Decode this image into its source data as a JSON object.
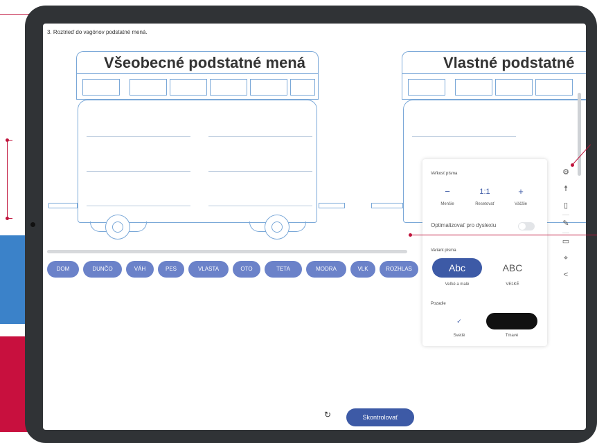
{
  "task": "3. Roztrieď do vagónov podstatné mená.",
  "wagons": [
    {
      "title": "Všeobecné podstatné mená"
    },
    {
      "title": "Vlastné podstatné"
    }
  ],
  "chips": [
    "DOM",
    "DUNČO",
    "VÁH",
    "PES",
    "VLASTA",
    "OTO",
    "TETA",
    "MODRA",
    "VLK",
    "ROZHLAS"
  ],
  "controls": {
    "undo_icon": "↻",
    "check_label": "Skontrolovať"
  },
  "settings": {
    "font_size_label": "Veľkosť písma",
    "smaller_symbol": "−",
    "smaller_label": "Menšie",
    "reset_symbol": "1:1",
    "reset_label": "Resetovať",
    "larger_symbol": "+",
    "larger_label": "Väčšie",
    "dyslexia_label": "Optimalizovať pro dyslexiu",
    "variant_label": "Variant písma",
    "variant_mixed": "Abc",
    "variant_mixed_caption": "Veľké a malé",
    "variant_upper": "ABC",
    "variant_upper_caption": "VEĽKÉ",
    "background_label": "Pozadie",
    "bg_light_mark": "✓",
    "bg_light_caption": "Svetlé",
    "bg_dark_caption": "Tmavé"
  },
  "colors": {
    "accent": "#3d5aa6",
    "chip": "#6b82c9",
    "annotation": "#c0143c",
    "wagon_stroke": "#7aa8d8"
  },
  "toolbar_icons": [
    "gear-icon",
    "accessibility-icon",
    "bookmark-icon",
    "pencil-icon",
    "screen-icon",
    "target-icon",
    "share-icon"
  ]
}
